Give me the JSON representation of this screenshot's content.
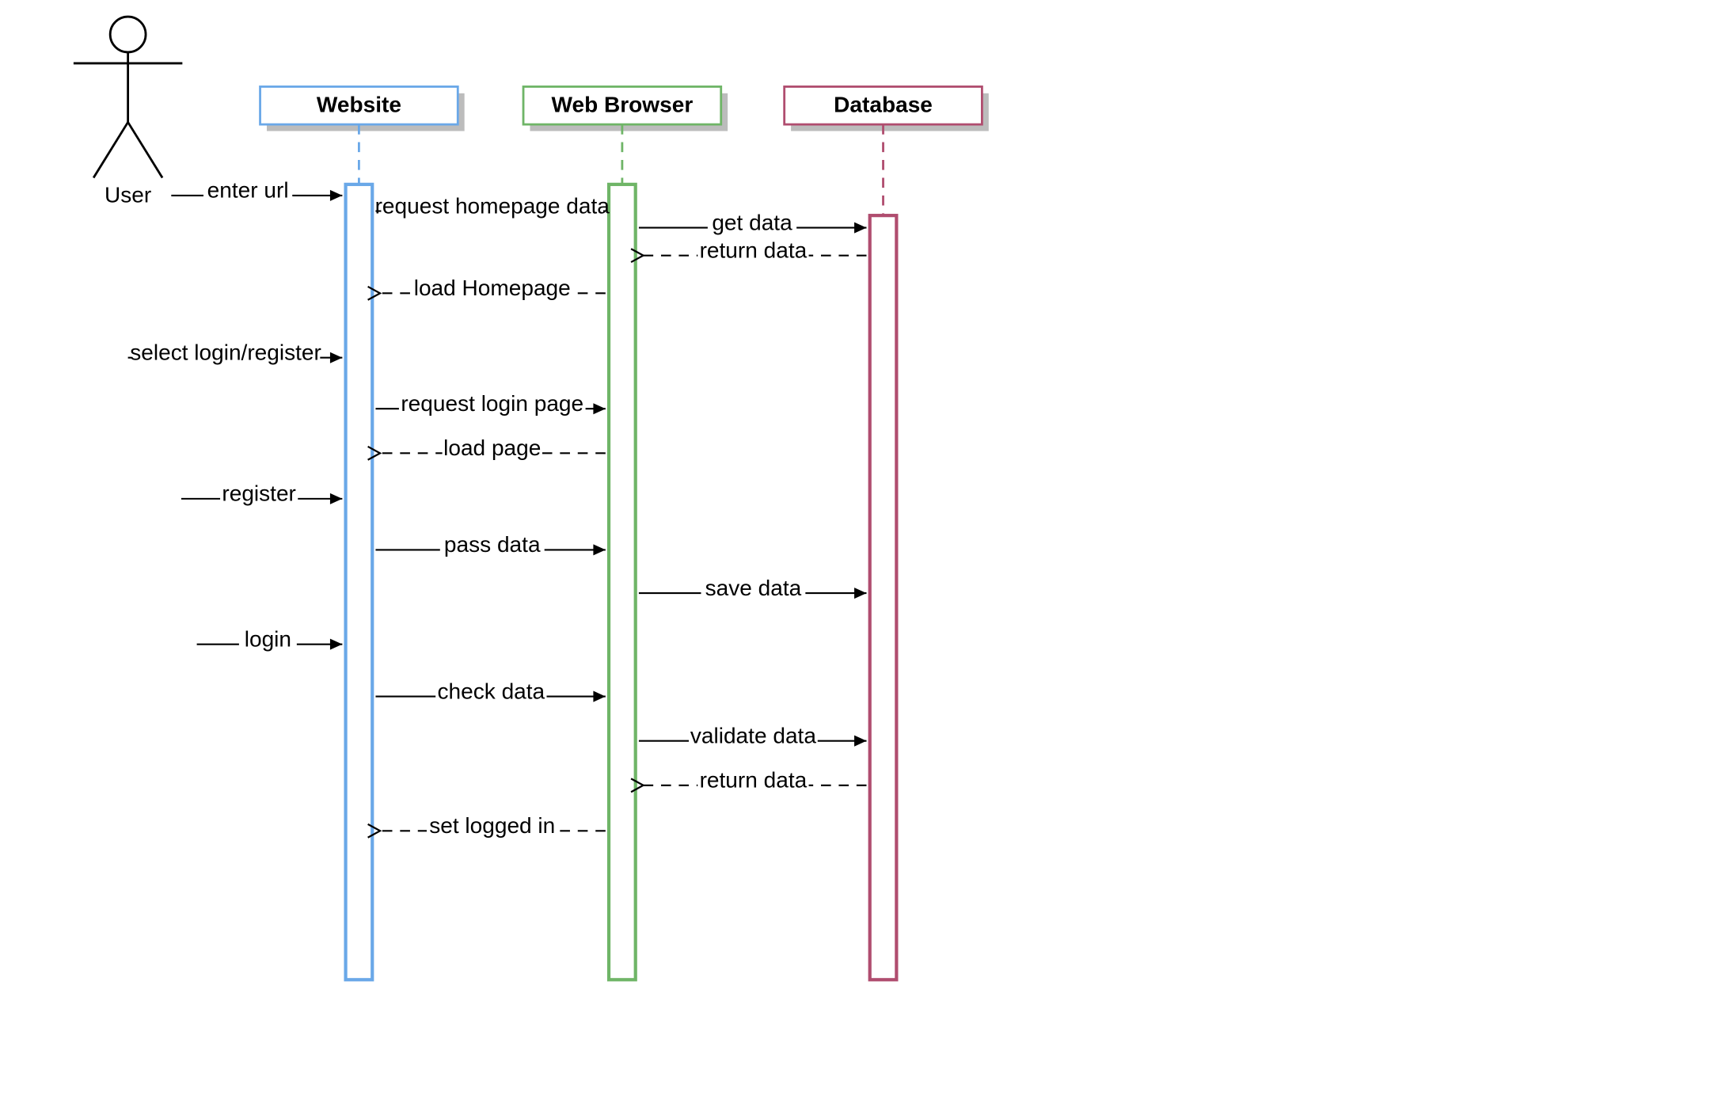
{
  "actor": {
    "label": "User"
  },
  "lifelines": {
    "website": {
      "label": "Website",
      "color": "#6aa8e8"
    },
    "browser": {
      "label": "Web Browser",
      "color": "#6fb567"
    },
    "database": {
      "label": "Database",
      "color": "#b04d6f"
    }
  },
  "messages": {
    "m1": "enter url",
    "m2": "request homepage data",
    "m3": "get data",
    "m4": "return data",
    "m5": "load Homepage",
    "m6": "select login/register",
    "m7": "request login page",
    "m8": "load page",
    "m9": "register",
    "m10": "pass data",
    "m11": "save data",
    "m12": "login",
    "m13": "check data",
    "m14": "validate data",
    "m15": "return data",
    "m16": "set logged in"
  }
}
